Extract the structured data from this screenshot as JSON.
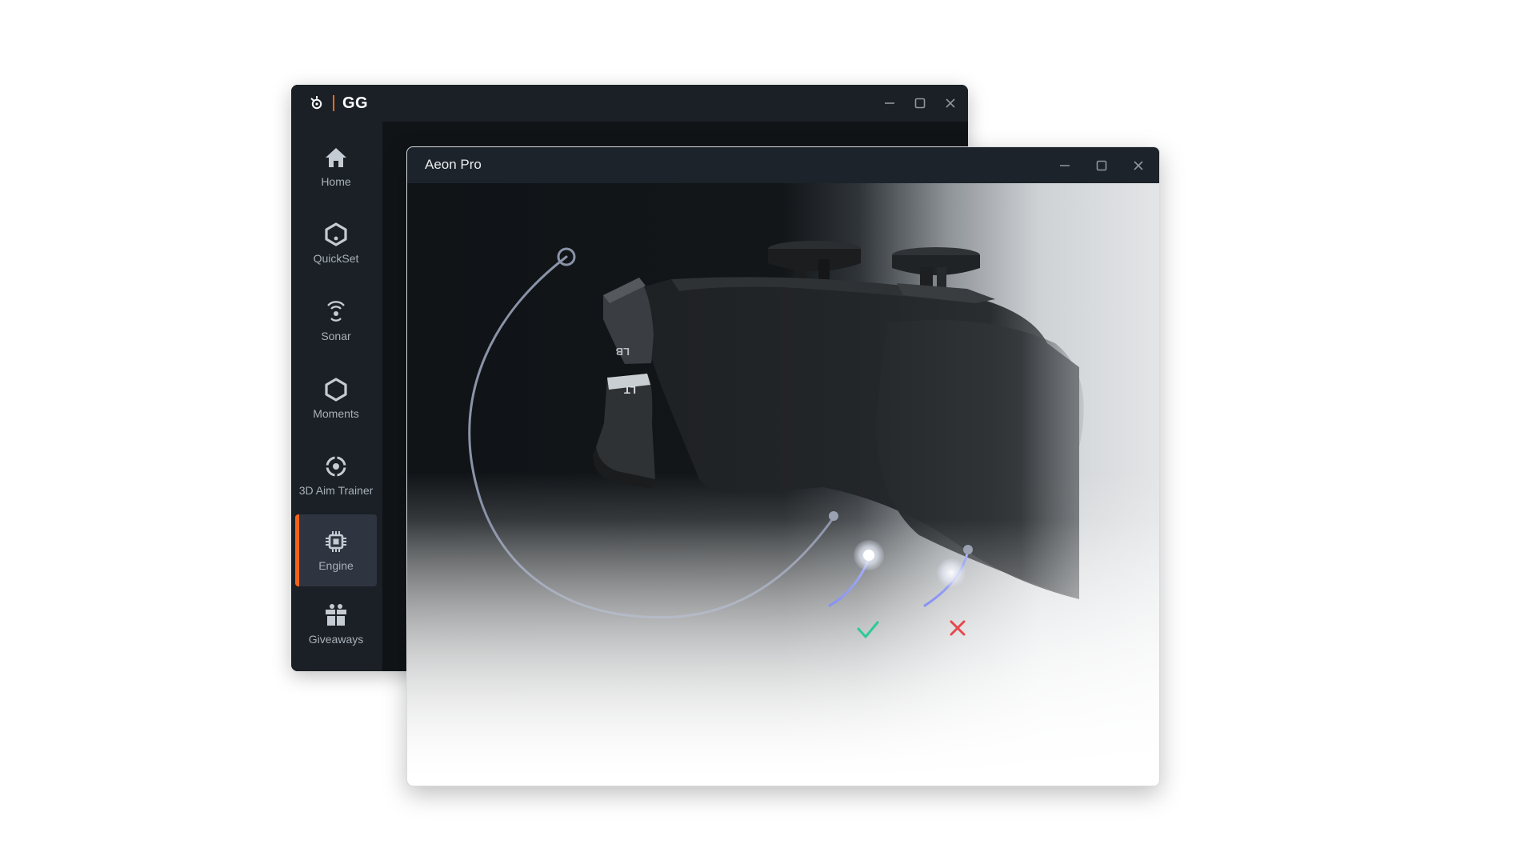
{
  "gg_window": {
    "logo_text": "GG",
    "accent_color": "#f26419",
    "controls": [
      "minimize-icon",
      "maximize-icon",
      "close-icon"
    ],
    "sidebar": {
      "items": [
        {
          "label": "Home",
          "icon": "home-icon",
          "active": false
        },
        {
          "label": "QuickSet",
          "icon": "quickset-icon",
          "active": false
        },
        {
          "label": "Sonar",
          "icon": "sonar-icon",
          "active": false
        },
        {
          "label": "Moments",
          "icon": "moments-icon",
          "active": false
        },
        {
          "label": "3D Aim Trainer",
          "icon": "aim-trainer-icon",
          "active": false
        },
        {
          "label": "Engine",
          "icon": "engine-chip-icon",
          "active": true
        },
        {
          "label": "Giveaways",
          "icon": "gift-icon",
          "active": false
        }
      ]
    }
  },
  "aeon_window": {
    "title": "Aeon Pro",
    "controls": [
      "minimize-icon",
      "maximize-icon",
      "close-icon"
    ],
    "illustration": {
      "subject": "controller-illustration",
      "trigger_labels": [
        "LB",
        "LT"
      ],
      "valid_indicator": "check-icon",
      "invalid_indicator": "cross-icon",
      "colors": {
        "valid": "#2ec99b",
        "invalid": "#e5484d",
        "curve": "#4b5cf0"
      }
    }
  }
}
